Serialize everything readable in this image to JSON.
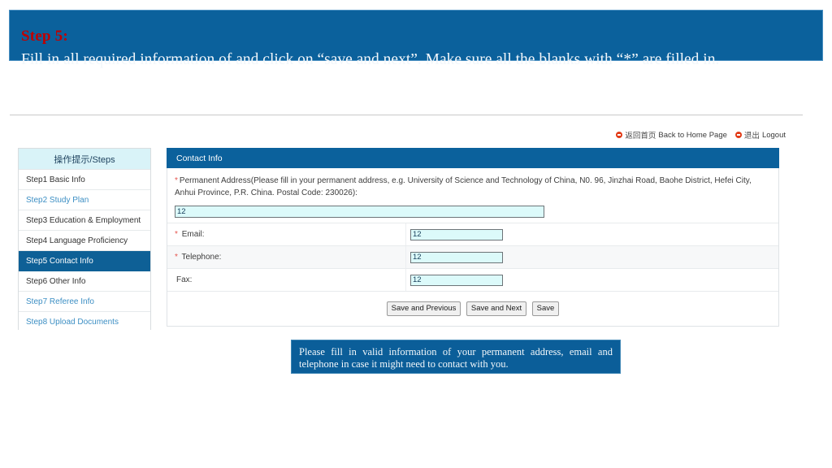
{
  "banner": {
    "step_label": "Step 5:",
    "instruction": "Fill in all required information of and click on “save and next”. Make sure all the blanks with “*” are filled in."
  },
  "top_links": [
    {
      "icon": "red-bullet-icon",
      "cn": "返回首页",
      "en": "Back to Home Page"
    },
    {
      "icon": "red-bullet-icon",
      "cn": "退出",
      "en": "Logout"
    }
  ],
  "sidebar": {
    "header": "操作提示/Steps",
    "items": [
      {
        "label": "Step1 Basic Info",
        "state": "normal"
      },
      {
        "label": "Step2 Study Plan",
        "state": "link"
      },
      {
        "label": "Step3 Education & Employment",
        "state": "normal"
      },
      {
        "label": "Step4 Language Proficiency",
        "state": "normal"
      },
      {
        "label": "Step5 Contact Info",
        "state": "active"
      },
      {
        "label": "Step6 Other Info",
        "state": "normal"
      },
      {
        "label": "Step7 Referee Info",
        "state": "link"
      },
      {
        "label": "Step8 Upload Documents",
        "state": "link"
      }
    ]
  },
  "panel": {
    "title": "Contact Info",
    "address": {
      "required_marker": "*",
      "label": "Permanent Address(Please fill in your permanent address, e.g. University of Science and Technology of China, N0. 96, Jinzhai Road, Baohe District, Hefei City, Anhui Province, P.R. China. Postal Code: 230026):",
      "value": "12"
    },
    "fields": [
      {
        "required_marker": "*",
        "label": "Email:",
        "value": "12",
        "alt": false
      },
      {
        "required_marker": "*",
        "label": "Telephone:",
        "value": "12",
        "alt": true
      },
      {
        "required_marker": "",
        "label": "Fax:",
        "value": "12",
        "alt": false
      }
    ],
    "buttons": [
      {
        "label": "Save and Previous"
      },
      {
        "label": "Save and Next"
      },
      {
        "label": "Save"
      }
    ]
  },
  "callout": {
    "text": "Please fill in valid information of your permanent address, email and telephone in case it might need to contact with you."
  },
  "colors": {
    "banner_blue": "#0b619c",
    "step_red": "#c00000",
    "sidebar_header": "#d9f3f8",
    "active_item": "#0e6096",
    "input_fill": "#dcfafa",
    "required_red": "#e5554e",
    "link_blue": "#3d8fc4"
  }
}
